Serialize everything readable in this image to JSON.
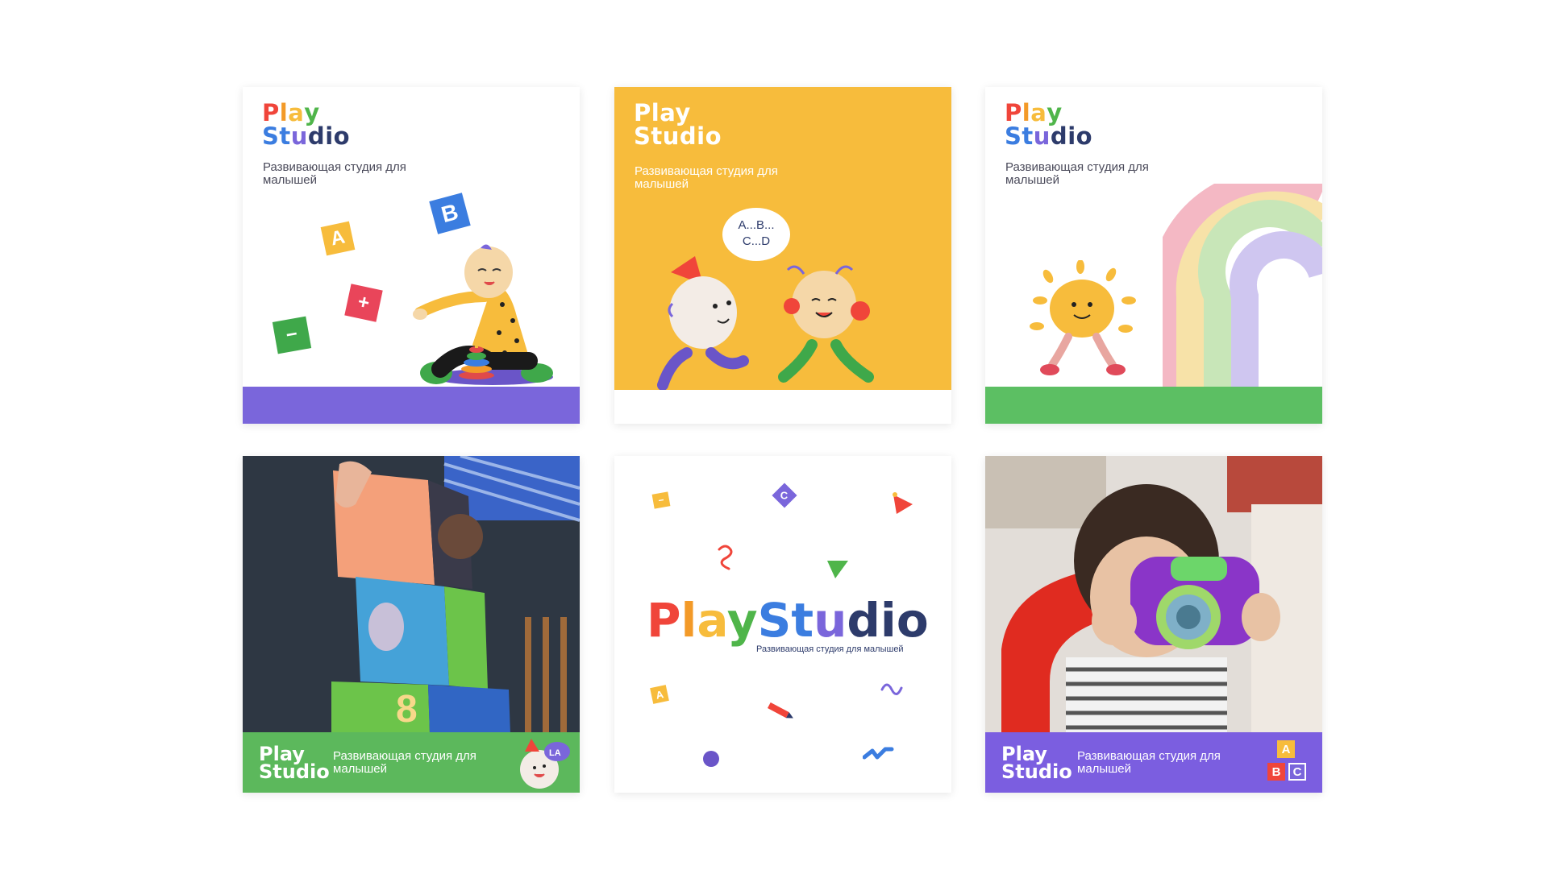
{
  "brand": {
    "play": "Play",
    "studio": "Studio",
    "full": "PlayStudio",
    "tagline": "Развивающая студия для малышей",
    "tagline_line1": "Развивающая студия для",
    "tagline_line2": "малышей"
  },
  "cards": [
    {
      "id": "card-1",
      "background": "#ffffff",
      "floor_color": "#7a66db",
      "letters": [
        "A",
        "B",
        "+",
        "−"
      ]
    },
    {
      "id": "card-2",
      "background": "#f7bc3c",
      "speech": [
        "A...B...",
        "C...D"
      ]
    },
    {
      "id": "card-3",
      "background": "#ffffff",
      "floor_color": "#5cbf63"
    },
    {
      "id": "card-4",
      "footer_color": "#5cb85c",
      "badge_text": "LA"
    },
    {
      "id": "card-5",
      "background": "#ffffff",
      "confetti_letters": [
        "C",
        "A"
      ]
    },
    {
      "id": "card-6",
      "footer_color": "#7b5ee0",
      "badge_letters": [
        "A",
        "B",
        "C"
      ]
    }
  ],
  "colors": {
    "red": "#f0453a",
    "orange": "#f39a28",
    "yellow": "#f7bc3c",
    "green": "#4fb54a",
    "blue": "#3b7de0",
    "purple": "#7a66db",
    "navy": "#2d3b6b"
  }
}
